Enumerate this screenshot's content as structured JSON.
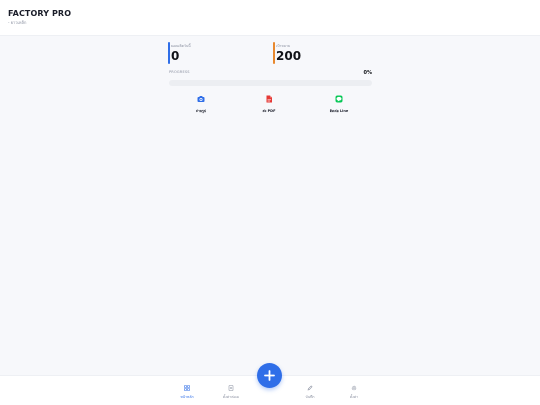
{
  "header": {
    "title": "FACTORY PRO",
    "subtitle": "- ยาวเหล็ก"
  },
  "stats": [
    {
      "label": "ยอดผลิตวันนี้",
      "value": "0",
      "color": "#2f6ee8"
    },
    {
      "label": "เป้าหมาย",
      "value": "200",
      "color": "#e8892f"
    }
  ],
  "progress": {
    "label": "PROGRESS",
    "percent_text": "0%",
    "fraction": 0.0
  },
  "actions": [
    {
      "label": "ถ่ายรูป",
      "icon": "camera-icon",
      "color": "#2f6ee8"
    },
    {
      "label": "ส่ง PDF",
      "icon": "pdf-icon",
      "color": "#e53935"
    },
    {
      "label": "ติดต่อ Line",
      "icon": "line-icon",
      "color": "#06c755"
    }
  ],
  "bottom_nav": {
    "items": [
      {
        "label": "หน้าหลัก",
        "icon": "grid-icon",
        "active": true
      },
      {
        "label": "ตั้งค่าต่อเม",
        "icon": "document-icon",
        "active": false
      },
      {
        "label": "บันทึก",
        "icon": "edit-icon",
        "active": false
      },
      {
        "label": "ตั้งค่า",
        "icon": "gear-icon",
        "active": false
      }
    ],
    "fab_icon": "plus-icon",
    "accent": "#2f6ee8"
  }
}
